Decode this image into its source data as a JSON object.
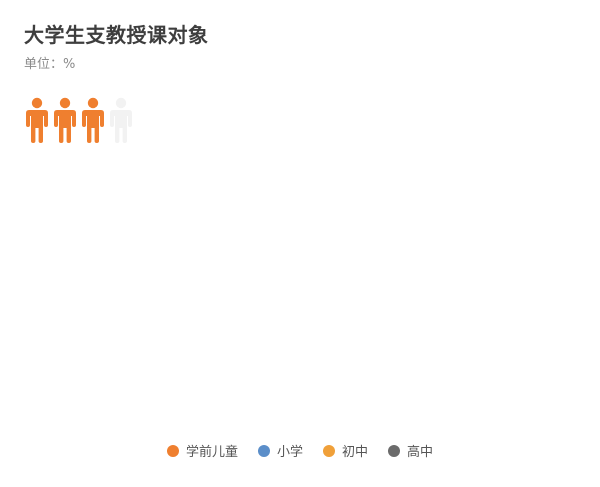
{
  "title": "大学生支教授课对象",
  "subtitle": "单位：%",
  "chart_data": {
    "type": "pictorial",
    "title": "大学生支教授课对象",
    "unit": "%",
    "icon": "person-icon",
    "icons_total": 4,
    "series": [
      {
        "name": "学前儿童",
        "color": "#ef7f2f",
        "filled_icons": 3,
        "visible": true
      },
      {
        "name": "小学",
        "color": "#5b8ec9",
        "visible": false
      },
      {
        "name": "初中",
        "color": "#f0a039",
        "visible": false
      },
      {
        "name": "高中",
        "color": "#6b6b6b",
        "visible": false
      }
    ],
    "empty_icon_color": "#f2f2f2",
    "legend_position": "bottom"
  }
}
